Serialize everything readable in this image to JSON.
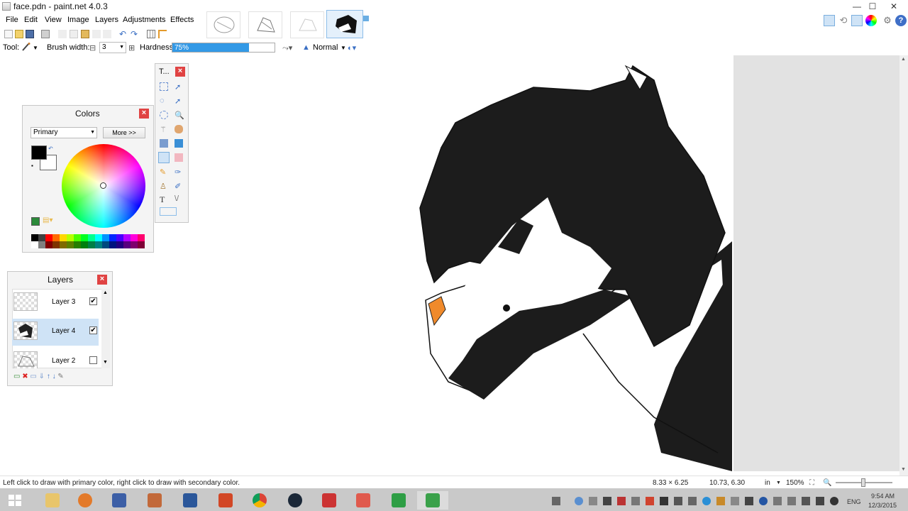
{
  "window": {
    "title": "face.pdn - paint.net 4.0.3",
    "minimize": "—",
    "maximize": "☐",
    "close": "✕"
  },
  "menu": [
    "File",
    "Edit",
    "View",
    "Image",
    "Layers",
    "Adjustments",
    "Effects"
  ],
  "toolbar2": {
    "tool_label": "Tool:",
    "brush_width_label": "Brush width:",
    "brush_width_value": "3",
    "hardness_label": "Hardness:",
    "hardness_value": "75%",
    "hardness_fraction": 0.75,
    "blend_mode": "Normal"
  },
  "tools_panel": {
    "title": "T..."
  },
  "colors_panel": {
    "title": "Colors",
    "mode": "Primary",
    "more_button": "More >>",
    "primary_color": "#000000",
    "secondary_color": "#ffffff",
    "palette": [
      "#000000",
      "#404040",
      "#ff0000",
      "#ff6a00",
      "#ffd800",
      "#b6ff00",
      "#4cff00",
      "#00ff21",
      "#00ff90",
      "#00ffff",
      "#0094ff",
      "#0026ff",
      "#4800ff",
      "#b200ff",
      "#ff00dc",
      "#ff006e",
      "#ffffff",
      "#808080",
      "#7f0000",
      "#7f3300",
      "#7f6a00",
      "#5b7f00",
      "#267f00",
      "#007f0e",
      "#007f46",
      "#007f7f",
      "#004a7f",
      "#00137f",
      "#21007f",
      "#57007f",
      "#7f006e",
      "#7f0037"
    ]
  },
  "layers_panel": {
    "title": "Layers",
    "layers": [
      {
        "name": "Layer 3",
        "visible": true,
        "selected": false
      },
      {
        "name": "Layer 4",
        "visible": true,
        "selected": true
      },
      {
        "name": "Layer 2",
        "visible": false,
        "selected": false
      }
    ]
  },
  "status": {
    "hint": "Left click to draw with primary color, right click to draw with secondary color.",
    "selection_size": "8.33 × 6.25",
    "cursor_pos": "10.73, 6.30",
    "units": "in",
    "zoom": "150%"
  },
  "taskbar": {
    "lang": "ENG",
    "time": "9:54 AM",
    "date": "12/3/2015"
  },
  "icons": {
    "close": "close-icon",
    "help": "help-icon",
    "settings": "gear-icon"
  }
}
